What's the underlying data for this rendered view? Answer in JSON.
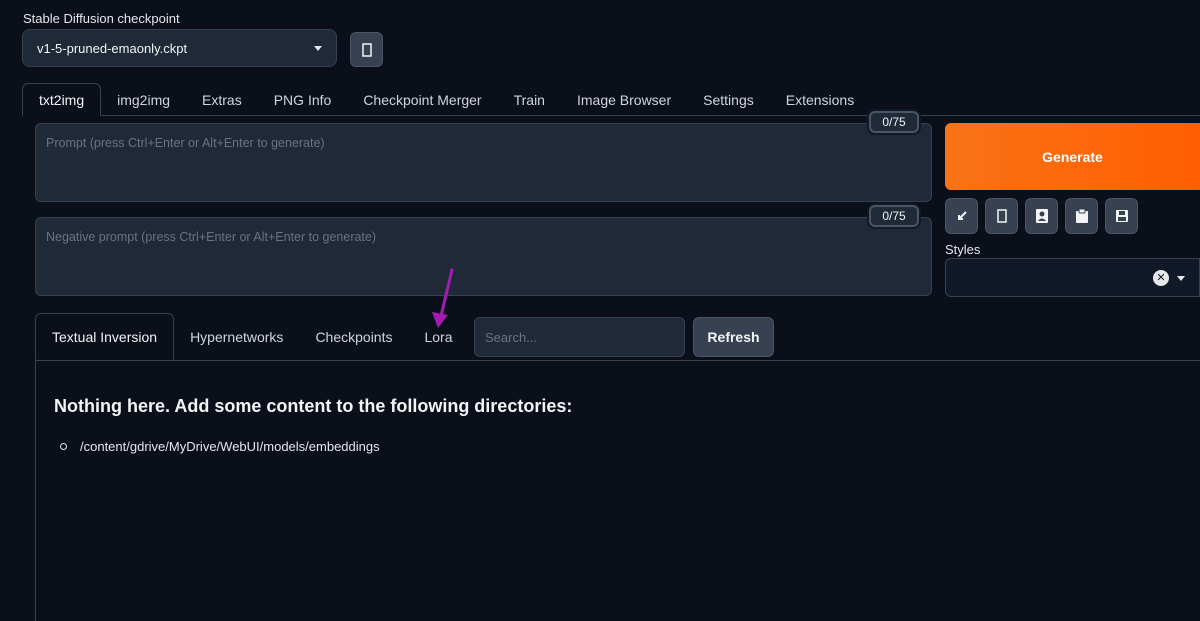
{
  "checkpoint": {
    "label": "Stable Diffusion checkpoint",
    "selected": "v1-5-pruned-emaonly.ckpt",
    "refresh_icon": "refresh-icon"
  },
  "main_tabs": [
    "txt2img",
    "img2img",
    "Extras",
    "PNG Info",
    "Checkpoint Merger",
    "Train",
    "Image Browser",
    "Settings",
    "Extensions"
  ],
  "prompt": {
    "placeholder": "Prompt (press Ctrl+Enter or Alt+Enter to generate)",
    "token_count": "0/75"
  },
  "negative_prompt": {
    "placeholder": "Negative prompt (press Ctrl+Enter or Alt+Enter to generate)",
    "token_count": "0/75"
  },
  "generate_label": "Generate",
  "tools": [
    "arrow-diagonal-icon",
    "trash-icon",
    "image-icon",
    "clipboard-icon",
    "save-icon"
  ],
  "styles": {
    "label": "Styles"
  },
  "extra_networks": {
    "tabs": [
      "Textual Inversion",
      "Hypernetworks",
      "Checkpoints",
      "Lora"
    ],
    "search_placeholder": "Search...",
    "refresh_label": "Refresh",
    "empty_message": "Nothing here. Add some content to the following directories:",
    "directories": [
      "/content/gdrive/MyDrive/WebUI/models/embeddings"
    ]
  },
  "colors": {
    "background": "#0b0f19",
    "accent": "#ff6a00",
    "annotation_arrow": "#a21caf"
  }
}
